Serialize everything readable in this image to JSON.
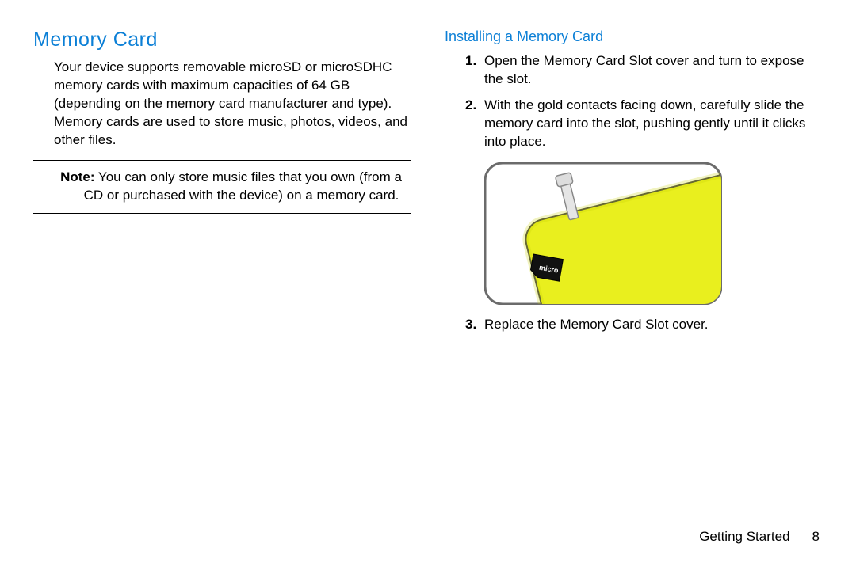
{
  "left": {
    "heading": "Memory Card",
    "intro": "Your device supports removable microSD or microSDHC memory cards with maximum capacities of 64 GB (depending on the memory card manufacturer and type). Memory cards are used to store music, photos, videos, and other files.",
    "note_label": "Note:",
    "note_text": " You can only store music files that you own (from a CD or purchased with the device) on a memory card."
  },
  "right": {
    "heading": "Installing a Memory Card",
    "steps": [
      {
        "num": "1.",
        "text": "Open the Memory Card Slot cover and turn to expose the slot."
      },
      {
        "num": "2.",
        "text": "With the gold contacts facing down, carefully slide the memory card into the slot, pushing gently until it clicks into place."
      },
      {
        "num": "3.",
        "text": "Replace the Memory Card Slot cover."
      }
    ]
  },
  "footer": {
    "section": "Getting Started",
    "page": "8"
  }
}
